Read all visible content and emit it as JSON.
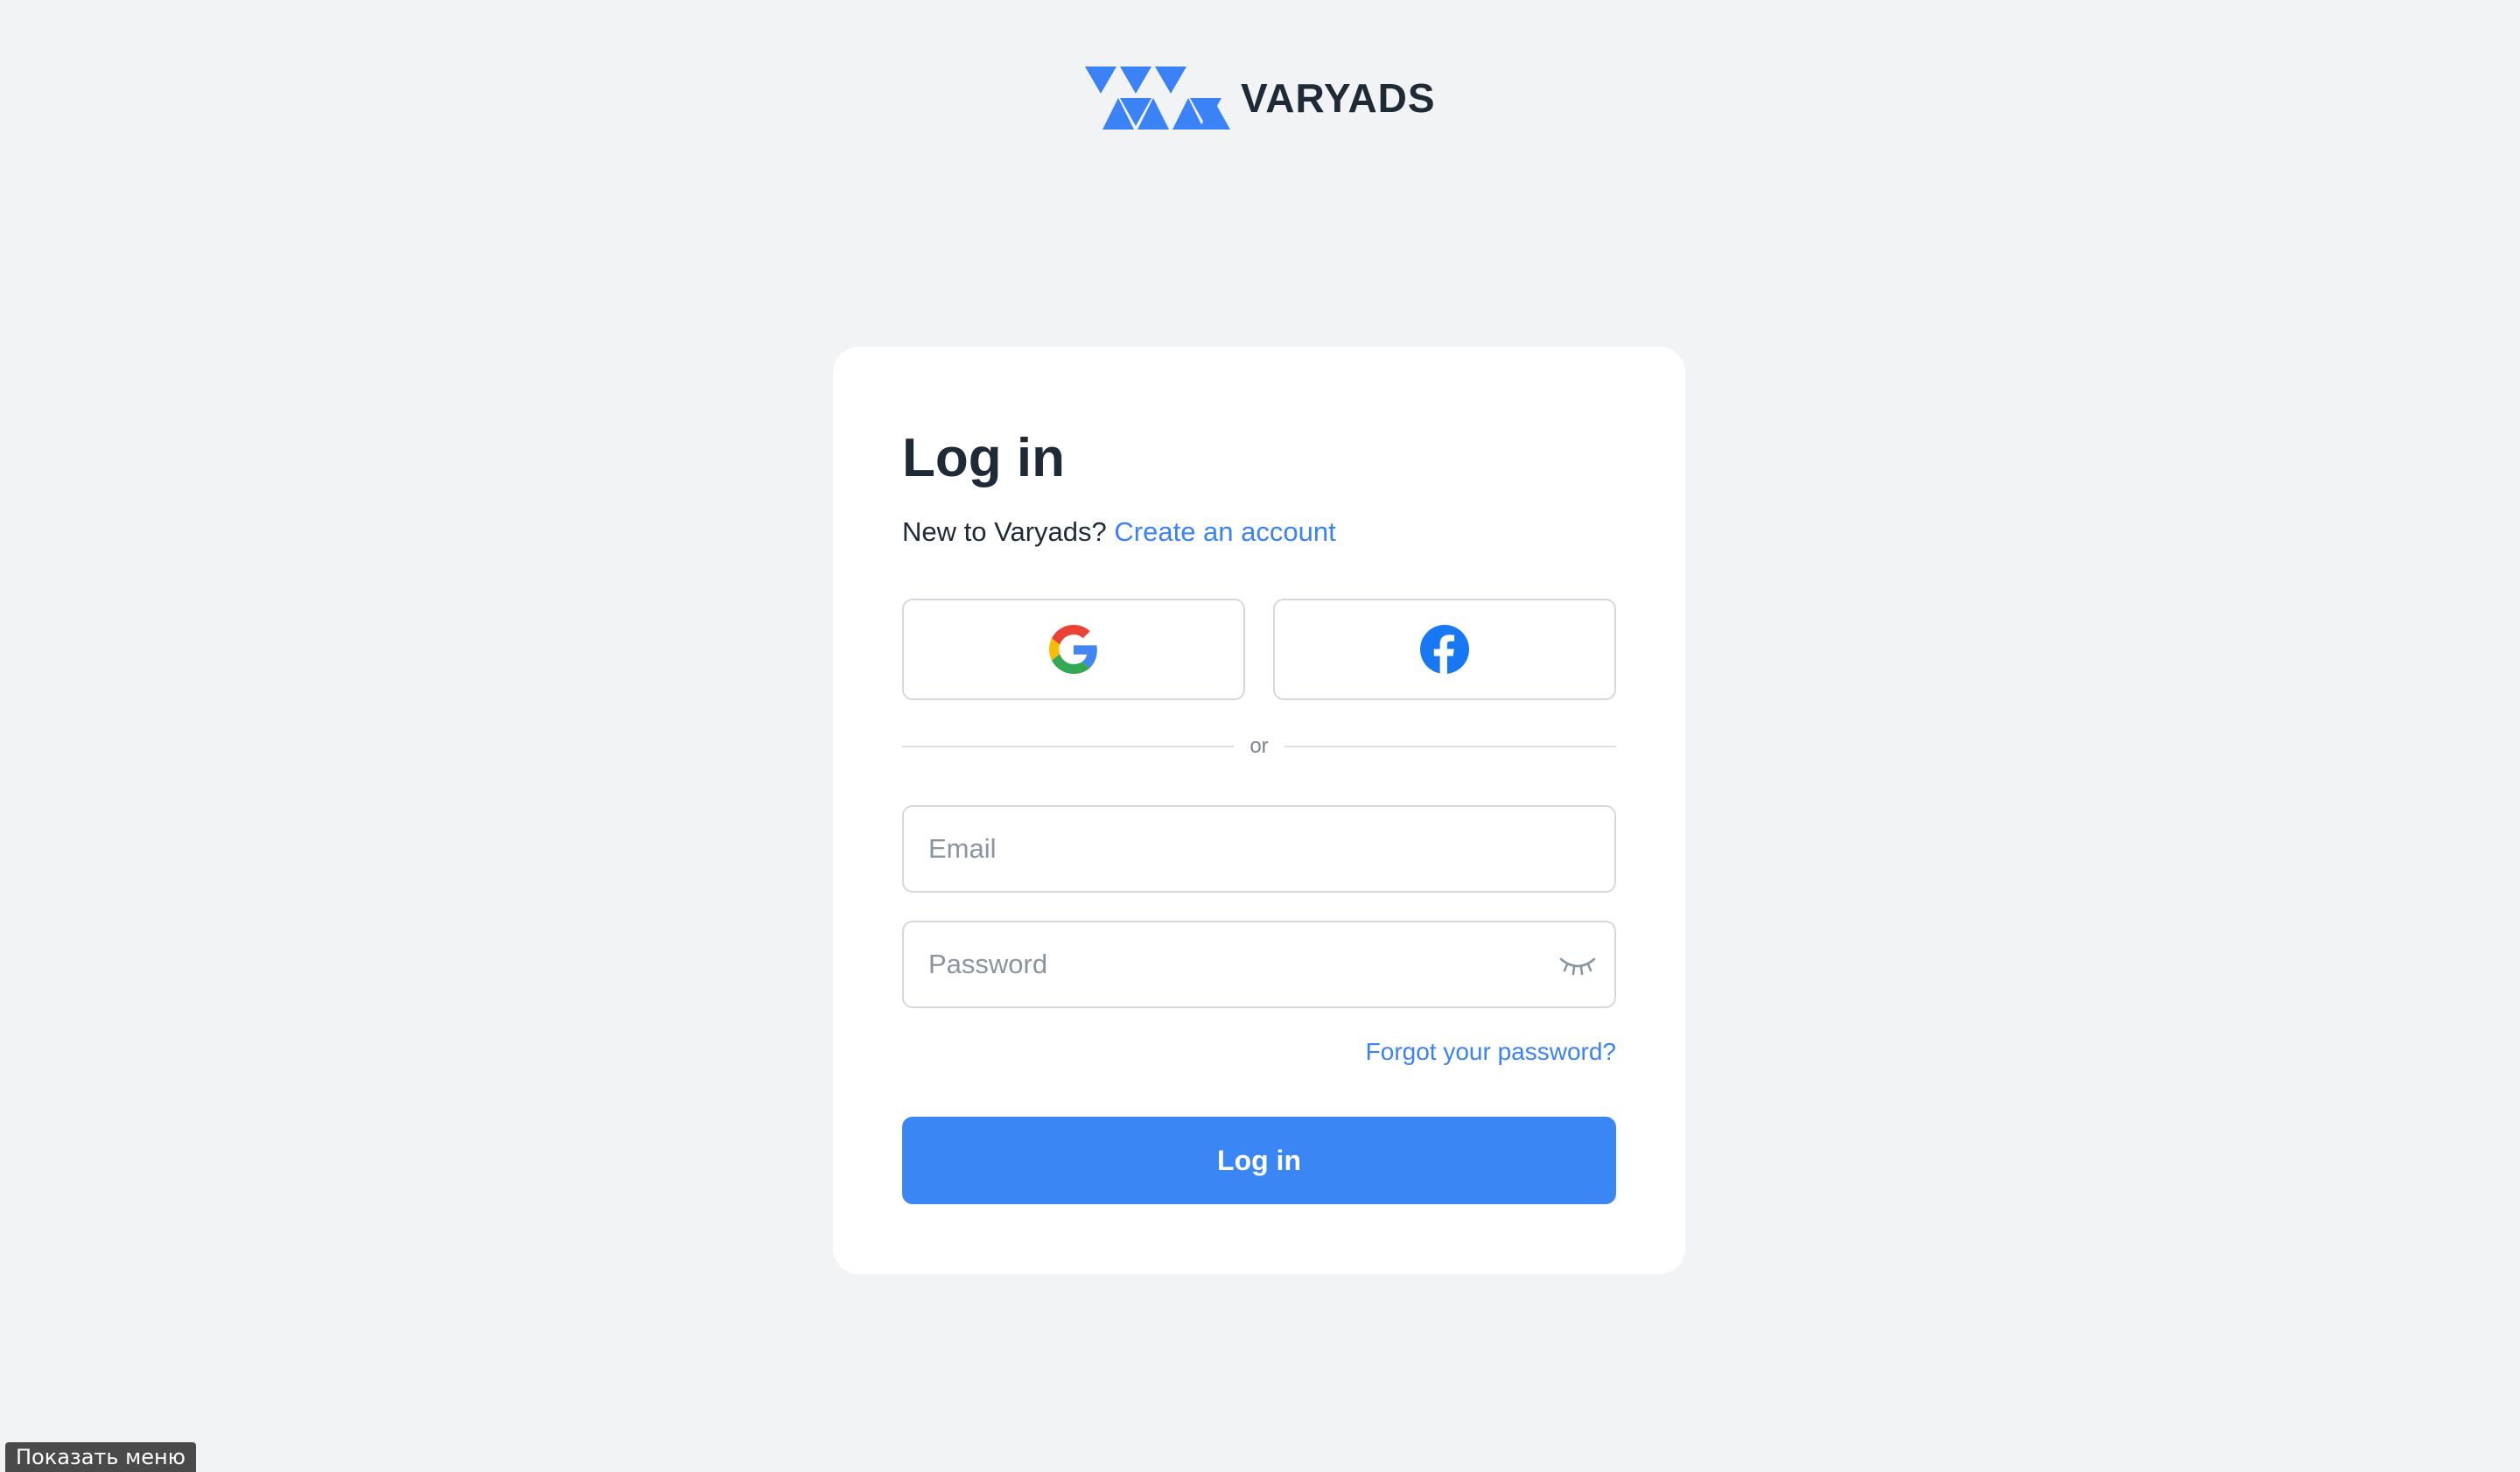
{
  "brand": {
    "name": "VARYADS",
    "logo_icon": "triangles-logo-icon",
    "accent_color": "#3b82f6"
  },
  "login": {
    "title": "Log in",
    "signup_prompt": "New to Varyads?",
    "signup_link": "Create an account",
    "social": {
      "google_icon": "google-icon",
      "facebook_icon": "facebook-icon"
    },
    "divider_text": "or",
    "email": {
      "placeholder": "Email",
      "value": ""
    },
    "password": {
      "placeholder": "Password",
      "value": "",
      "toggle_icon": "eye-closed-icon"
    },
    "forgot_link": "Forgot your password?",
    "submit_label": "Log in"
  },
  "overlay": {
    "menu_label": "Показать меню"
  },
  "colors": {
    "background": "#f1f3f5",
    "button": "#3b86f5",
    "link": "#3b82f6",
    "text": "#1f2a37"
  }
}
